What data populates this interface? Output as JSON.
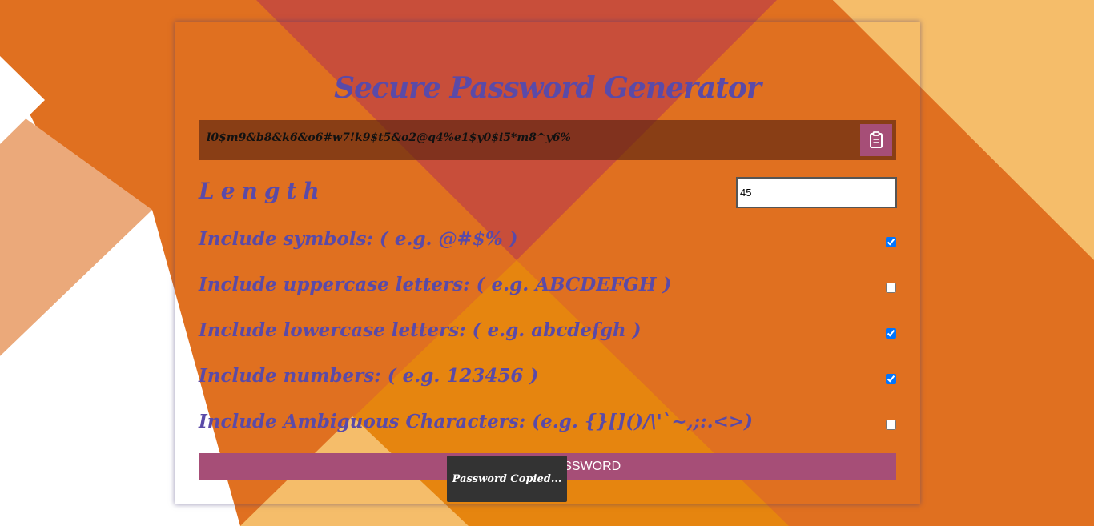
{
  "app": {
    "title": "Secure Password Generator"
  },
  "password": {
    "value": "l0$m9&b8&k6&o6#w7!k9$t5&o2@q4%e1$y0$i5*m8^y6%",
    "copy_icon": "clipboard-icon"
  },
  "length": {
    "label": "Length",
    "value": "45"
  },
  "options": [
    {
      "label": "Include symbols: ( e.g. @#$% )",
      "checked": true
    },
    {
      "label": "Include uppercase letters: ( e.g. ABCDEFGH )",
      "checked": false
    },
    {
      "label": "Include lowercase letters: ( e.g. abcdefgh )",
      "checked": true
    },
    {
      "label": "Include numbers: ( e.g. 123456 )",
      "checked": true
    },
    {
      "label": "Include Ambiguous Characters: (e.g. {}[]()/\\'`~,;:.<>)",
      "checked": false
    }
  ],
  "generate_button": {
    "label": "GENERATE PASSWORD"
  },
  "toast": {
    "message": "Password Copied..."
  },
  "colors": {
    "accent": "#a64e77",
    "title": "#5a4aa8",
    "orange": "#e07020",
    "light_orange": "#f5bd6a"
  }
}
